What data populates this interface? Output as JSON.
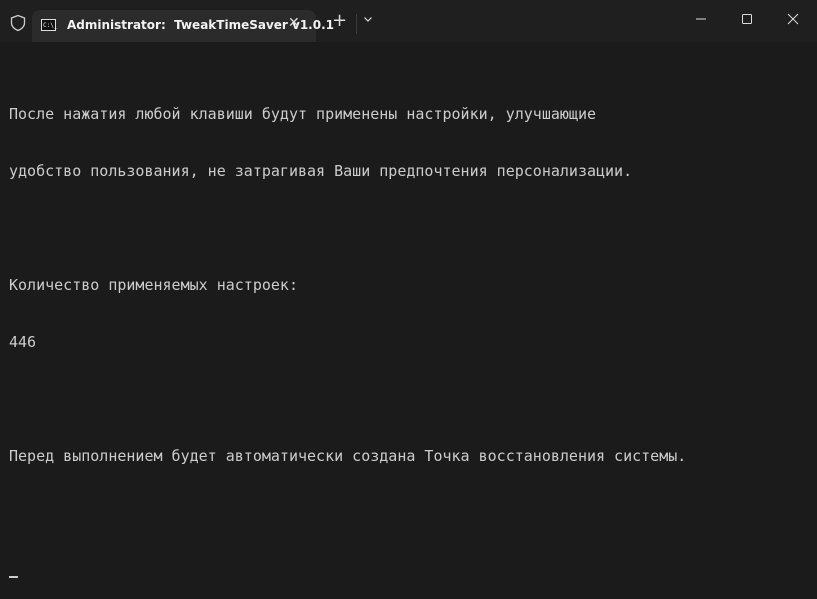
{
  "window": {
    "tab_title": "Administrator:  TweakTimeSaver v1.0.1",
    "tab_icon_text": "C:\\_",
    "close_tab": "✕",
    "new_tab": "+",
    "dropdown": "⌄",
    "minimize": "—",
    "maximize": "☐",
    "close": "✕"
  },
  "terminal": {
    "lines": [
      "После нажатия любой клавиши будут применены настройки, улучшающие",
      "удобство пользования, не затрагивая Ваши предпочтения персонализации.",
      "",
      "Количество применяемых настроек:",
      "446",
      "",
      "Перед выполнением будет автоматически создана Точка восстановления системы.",
      ""
    ]
  }
}
